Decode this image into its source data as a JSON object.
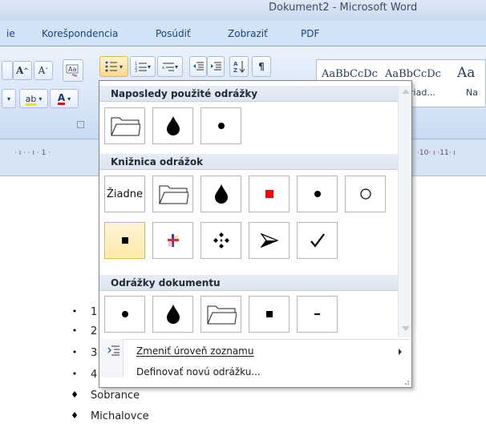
{
  "window": {
    "title": "Dokument2 - Microsoft Word"
  },
  "tabs": [
    "ie",
    "Korešpondencia",
    "Posúdiť",
    "Zobraziť",
    "PDF"
  ],
  "ribbon": {
    "font_grow": "A",
    "font_shrink": "A",
    "highlight_label": "ab",
    "font_color": "A",
    "pilcrow": "¶",
    "styles": [
      {
        "preview": "AaBbCcDc",
        "label": ""
      },
      {
        "preview": "AaBbCcDc",
        "label": "ez riad..."
      },
      {
        "preview": "Aa",
        "label": "Na"
      }
    ]
  },
  "ruler": {
    "left_text": "· ı ·   · ı · 1 ·",
    "right_text": "·10· ı ·11· ı"
  },
  "gallery": {
    "sections": {
      "recent": "Naposledy použité odrážky",
      "library": "Knižnica odrážok",
      "document": "Odrážky dokumentu"
    },
    "recent_bullets": [
      "folder-bullet-icon",
      "drop-bullet-icon",
      "dot-bullet-icon"
    ],
    "library_bullets": [
      "Žiadne",
      "folder-bullet-icon",
      "drop-bullet-icon",
      "red-square-bullet-icon",
      "dot-bullet-icon",
      "circle-bullet-icon",
      "square-bullet-icon",
      "cross-bullet-icon",
      "diamond-cluster-bullet-icon",
      "arrowhead-bullet-icon",
      "checkmark-bullet-icon"
    ],
    "document_bullets": [
      "dot-bullet-icon",
      "drop-bullet-icon",
      "folder-bullet-icon",
      "square-bullet-icon",
      "dash-bullet-icon"
    ],
    "change_level": "Zmeniť úroveň zoznamu",
    "define_new": "Definovať novú odrážku...",
    "accent_red": "#ff0000"
  },
  "document": {
    "items": [
      {
        "bullet": "•",
        "text": "1"
      },
      {
        "bullet": "•",
        "text": "2"
      },
      {
        "bullet": "•",
        "text": "3"
      },
      {
        "bullet": "•",
        "text": "4"
      },
      {
        "bullet": "♦",
        "text": "Sobrance"
      },
      {
        "bullet": "♦",
        "text": "Michalovce"
      }
    ]
  }
}
